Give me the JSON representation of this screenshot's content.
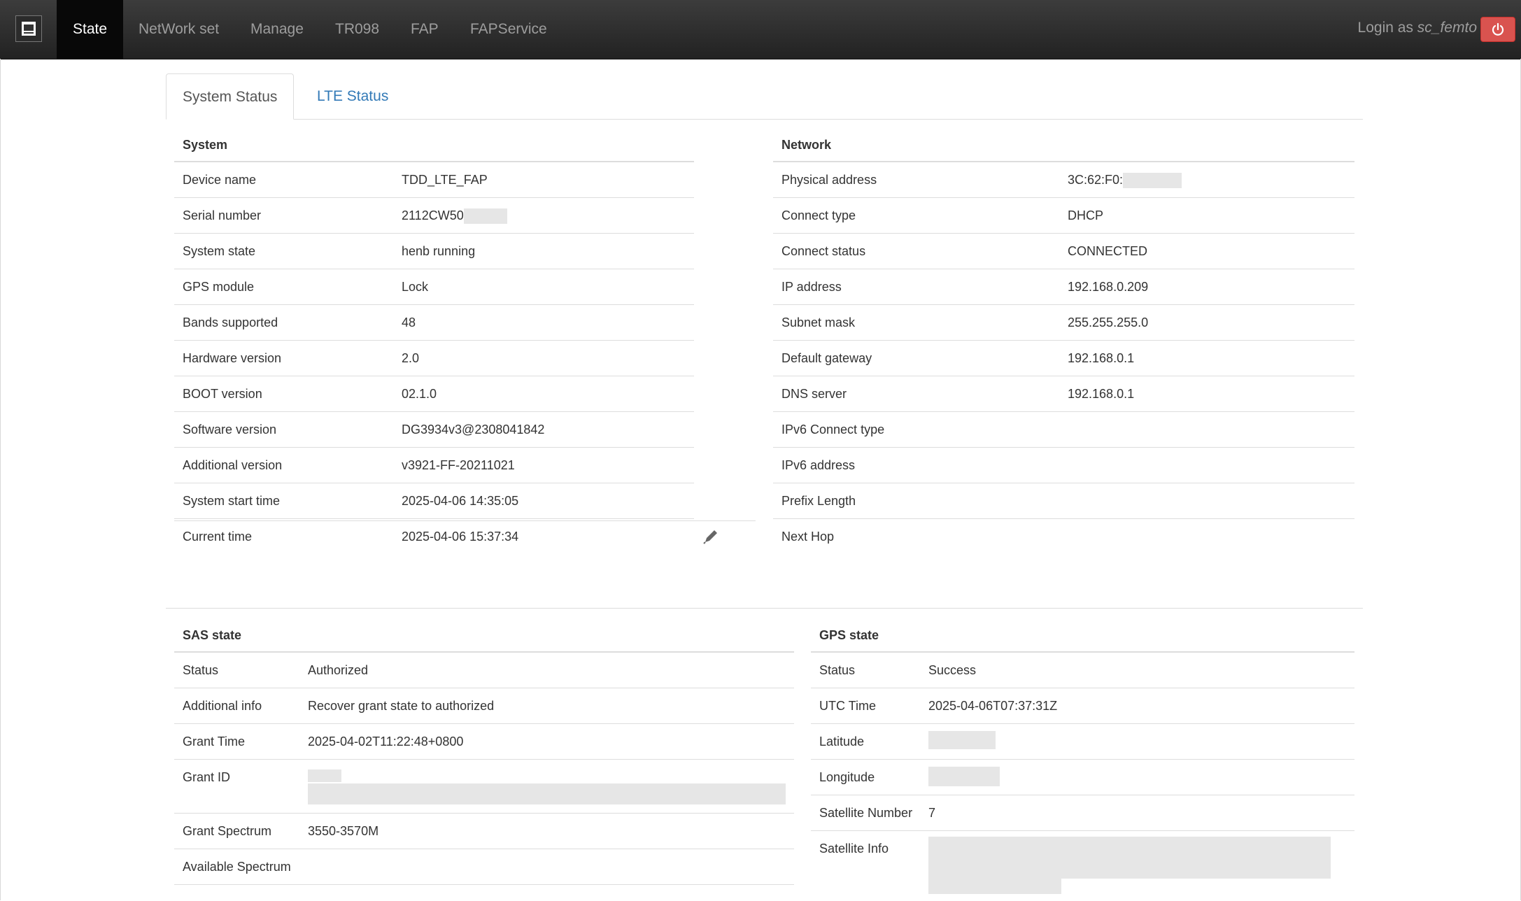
{
  "nav": {
    "items": [
      "State",
      "NetWork set",
      "Manage",
      "TR098",
      "FAP",
      "FAPService"
    ],
    "login_prefix": "Login as",
    "login_user": "sc_femto"
  },
  "tabs": [
    "System Status",
    "LTE Status"
  ],
  "system": {
    "title": "System",
    "rows": [
      {
        "key": "Device name",
        "value": "TDD_LTE_FAP"
      },
      {
        "key": "Serial number",
        "value": "2112CW50"
      },
      {
        "key": "System state",
        "value": "henb running"
      },
      {
        "key": "GPS module",
        "value": "Lock"
      },
      {
        "key": "Bands supported",
        "value": "48"
      },
      {
        "key": "Hardware version",
        "value": "2.0"
      },
      {
        "key": "BOOT version",
        "value": "02.1.0"
      },
      {
        "key": "Software version",
        "value": "DG3934v3@2308041842"
      },
      {
        "key": "Additional version",
        "value": "v3921-FF-20211021"
      },
      {
        "key": "System start time",
        "value": "2025-04-06 14:35:05"
      },
      {
        "key": "Current time",
        "value": "2025-04-06 15:37:34"
      }
    ]
  },
  "network": {
    "title": "Network",
    "rows": [
      {
        "key": "Physical address",
        "value": "3C:62:F0:"
      },
      {
        "key": "Connect type",
        "value": "DHCP"
      },
      {
        "key": "Connect status",
        "value": "CONNECTED"
      },
      {
        "key": "IP address",
        "value": "192.168.0.209"
      },
      {
        "key": "Subnet mask",
        "value": "255.255.255.0"
      },
      {
        "key": "Default gateway",
        "value": "192.168.0.1"
      },
      {
        "key": "DNS server",
        "value": "192.168.0.1"
      },
      {
        "key": "IPv6 Connect type",
        "value": ""
      },
      {
        "key": "IPv6 address",
        "value": ""
      },
      {
        "key": "Prefix Length",
        "value": ""
      },
      {
        "key": "Next Hop",
        "value": ""
      }
    ]
  },
  "sas": {
    "title": "SAS state",
    "rows": [
      {
        "key": "Status",
        "value": "Authorized"
      },
      {
        "key": "Additional info",
        "value": "Recover grant state to authorized"
      },
      {
        "key": "Grant Time",
        "value": "2025-04-02T11:22:48+0800"
      },
      {
        "key": "Grant ID",
        "value": ""
      },
      {
        "key": "Grant Spectrum",
        "value": "3550-3570M"
      },
      {
        "key": "Available Spectrum",
        "value": ""
      }
    ]
  },
  "gps": {
    "title": "GPS state",
    "rows": [
      {
        "key": "Status",
        "value": "Success"
      },
      {
        "key": "UTC Time",
        "value": "2025-04-06T07:37:31Z"
      },
      {
        "key": "Latitude",
        "value": ""
      },
      {
        "key": "Longitude",
        "value": ""
      },
      {
        "key": "Satellite Number",
        "value": "7"
      },
      {
        "key": "Satellite Info",
        "value": ""
      }
    ]
  },
  "colors": {
    "navbar": "#222222",
    "nav_active": "#080808",
    "link": "#337ab7",
    "power_button": "#d9534f"
  },
  "icons": {
    "brand": "logo-icon",
    "power": "power-icon",
    "edit": "pencil-icon"
  }
}
